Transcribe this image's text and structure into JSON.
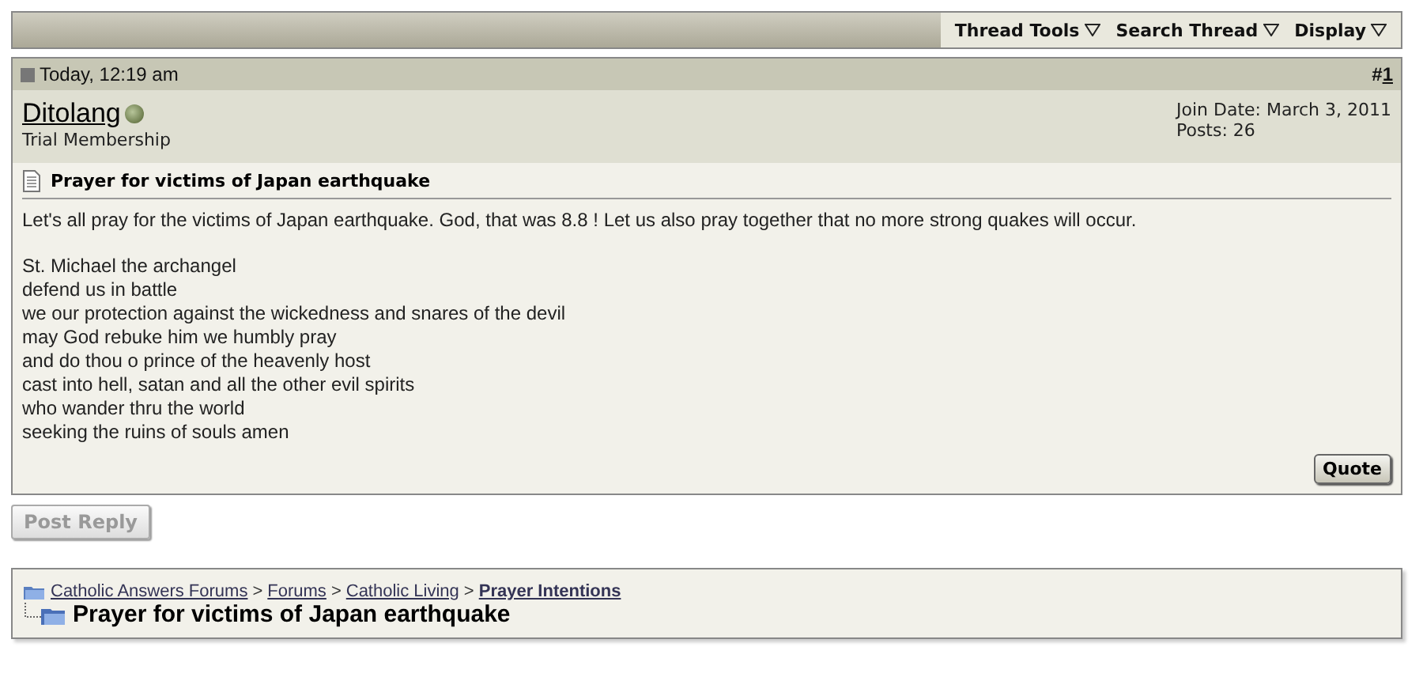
{
  "toolbar": {
    "menus": [
      {
        "label": "Thread Tools"
      },
      {
        "label": "Search Thread"
      },
      {
        "label": "Display"
      }
    ]
  },
  "post": {
    "date": "Today, 12:19 am",
    "number_prefix": "#",
    "number": "1",
    "username": "Ditolang",
    "online": true,
    "user_title": "Trial Membership",
    "join_date": "Join Date: March 3, 2011",
    "posts": "Posts: 26",
    "title": "Prayer for victims of Japan earthquake",
    "intro": "Let's all pray for the victims of Japan earthquake. God, that was 8.8 ! Let us also pray together that no more strong quakes will occur.",
    "lines": [
      "St. Michael the archangel",
      "defend us in battle",
      "we our protection against the wickedness and snares of the devil",
      "may God rebuke him we humbly pray",
      "and do thou o prince of the heavenly host",
      "cast into hell, satan and all the other evil spirits",
      "who wander thru the world",
      "seeking the ruins of souls amen"
    ],
    "quote_button": "Quote"
  },
  "post_reply": {
    "label": "Post Reply",
    "disabled": true
  },
  "breadcrumb": {
    "links": [
      {
        "label": "Catholic Answers Forums",
        "current": false
      },
      {
        "label": "Forums",
        "current": false
      },
      {
        "label": "Catholic Living",
        "current": false
      },
      {
        "label": "Prayer Intentions",
        "current": true
      }
    ],
    "separator": ">",
    "thread_title": "Prayer for victims of Japan earthquake"
  }
}
